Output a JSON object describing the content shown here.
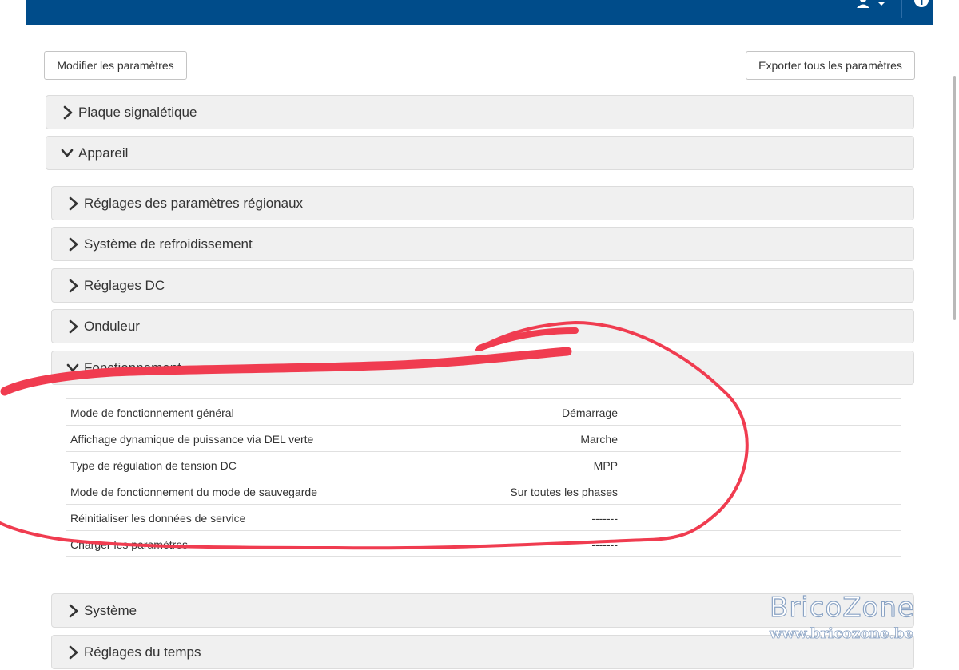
{
  "toolbar": {
    "modify_label": "Modifier les paramètres",
    "export_label": "Exporter tous les paramètres"
  },
  "sections": {
    "nameplate": {
      "label": "Plaque signalétique",
      "expanded": false
    },
    "device": {
      "label": "Appareil",
      "expanded": true,
      "subsections": {
        "regional": {
          "label": "Réglages des paramètres régionaux",
          "expanded": false
        },
        "cooling": {
          "label": "Système de refroidissement",
          "expanded": false
        },
        "dc": {
          "label": "Réglages DC",
          "expanded": false
        },
        "inverter": {
          "label": "Onduleur",
          "expanded": false
        },
        "operation": {
          "label": "Fonctionnement",
          "expanded": true,
          "rows": [
            {
              "name": "Mode de fonctionnement général",
              "value": "Démarrage"
            },
            {
              "name": "Affichage dynamique de puissance via DEL verte",
              "value": "Marche"
            },
            {
              "name": "Type de régulation de tension DC",
              "value": "MPP"
            },
            {
              "name": "Mode de fonctionnement du mode de sauvegarde",
              "value": "Sur toutes les phases"
            },
            {
              "name": "Réinitialiser les données de service",
              "value": "-------"
            },
            {
              "name": "Charger les paramètres",
              "value": "-------"
            }
          ]
        },
        "system": {
          "label": "Système",
          "expanded": false
        },
        "time": {
          "label": "Réglages du temps",
          "expanded": false
        }
      }
    }
  },
  "watermark": {
    "brand": "BricoZone",
    "url": "www.bricozone.be"
  },
  "colors": {
    "topbar": "#004c8a",
    "panel_bg": "#f0f0f0",
    "annotation": "#f03c50"
  },
  "icons": {
    "collapsed": "chevron-right-icon",
    "expanded": "chevron-down-icon",
    "user": "user-icon",
    "help": "help-icon",
    "dropdown": "caret-down-icon"
  }
}
